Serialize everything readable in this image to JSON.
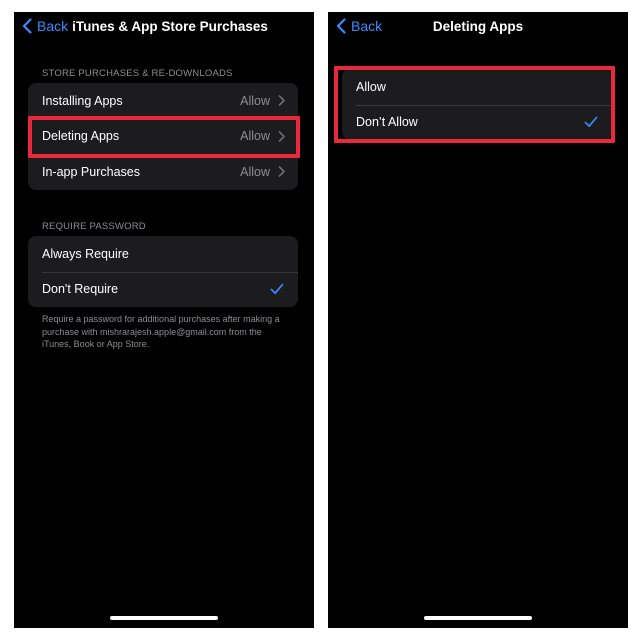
{
  "left_screen": {
    "back_label": "Back",
    "title": "iTunes & App Store Purchases",
    "store_section": {
      "header": "STORE PURCHASES & RE-DOWNLOADS",
      "rows": [
        {
          "label": "Installing Apps",
          "value": "Allow"
        },
        {
          "label": "Deleting Apps",
          "value": "Allow"
        },
        {
          "label": "In-app Purchases",
          "value": "Allow"
        }
      ]
    },
    "password_section": {
      "header": "REQUIRE PASSWORD",
      "rows": [
        {
          "label": "Always Require",
          "selected": false
        },
        {
          "label": "Don't Require",
          "selected": true
        }
      ],
      "footer": "Require a password for additional purchases after making a purchase with mishrarajesh.apple@gmail.com from the iTunes, Book or App Store."
    }
  },
  "right_screen": {
    "back_label": "Back",
    "title": "Deleting Apps",
    "rows": [
      {
        "label": "Allow",
        "selected": false
      },
      {
        "label": "Don’t Allow",
        "selected": true
      }
    ]
  },
  "colors": {
    "accent": "#3a8bff",
    "highlight": "#e8283c",
    "background": "#000000",
    "group_background": "#1c1c1e",
    "secondary_text": "#8e8e93"
  },
  "icons": {
    "back": "chevron-left-icon",
    "disclosure": "chevron-right-icon",
    "selected": "checkmark-icon"
  }
}
